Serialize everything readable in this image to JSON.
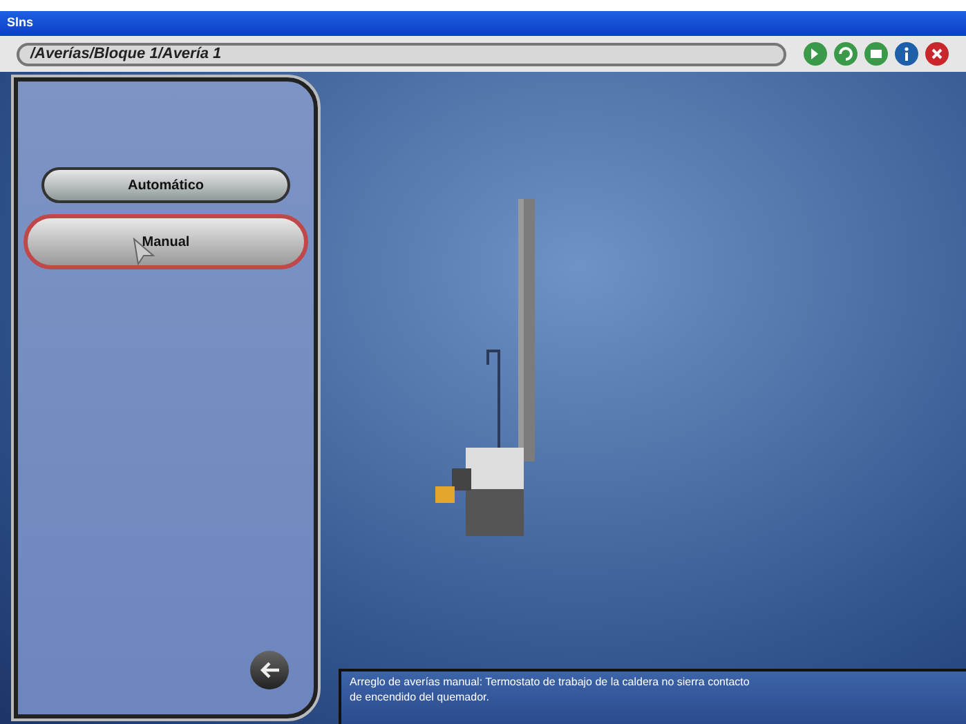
{
  "window": {
    "title": "Slns"
  },
  "path": "/Averías/Bloque 1/Avería 1",
  "toolbar": [
    {
      "kind": "forward",
      "color": "#3a9a4a"
    },
    {
      "kind": "reload",
      "color": "#3a9a4a"
    },
    {
      "kind": "print",
      "color": "#3a9a4a"
    },
    {
      "kind": "info",
      "color": "#1d5fa8"
    },
    {
      "kind": "close",
      "color": "#c8262b"
    }
  ],
  "modes": [
    {
      "label": "Automático",
      "selected": false
    },
    {
      "label": "Manual",
      "selected": true
    }
  ],
  "message": "Arreglo de averías manual: Termostato de trabajo de la caldera no sierra contacto de encendido del quemador."
}
